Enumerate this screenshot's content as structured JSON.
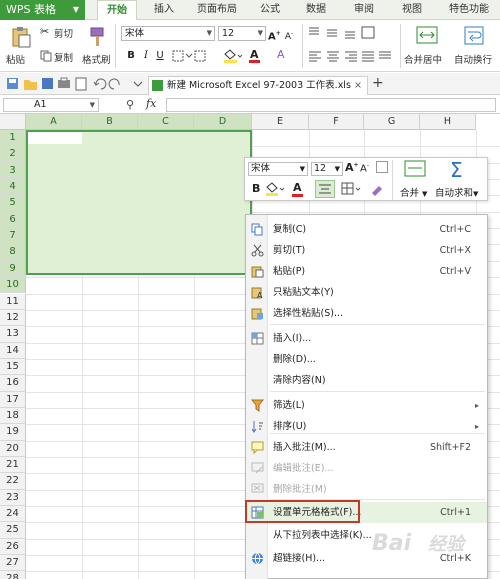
{
  "app": {
    "name": "WPS 表格"
  },
  "menu": {
    "tabs": [
      "开始",
      "插入",
      "页面布局",
      "公式",
      "数据",
      "审阅",
      "视图",
      "特色功能"
    ],
    "active": "开始"
  },
  "ribbon": {
    "paste": "粘贴",
    "cut": "剪切",
    "copy": "复制",
    "format_painter": "格式刷",
    "font": "宋体",
    "font_size": "12",
    "merge": "合并居中",
    "autowrap": "自动换行"
  },
  "file_tab": {
    "name": "新建 Microsoft Excel 97-2003 工作表.xls"
  },
  "formula_bar": {
    "name_box": "A1",
    "fx": "fx",
    "zoom_icon": "magnifier-icon"
  },
  "grid": {
    "columns": [
      "A",
      "B",
      "C",
      "D",
      "E",
      "F",
      "G",
      "H"
    ],
    "rows": [
      "1",
      "2",
      "3",
      "4",
      "5",
      "6",
      "7",
      "8",
      "9",
      "10",
      "11",
      "12",
      "13",
      "14",
      "15",
      "16",
      "17",
      "18",
      "19",
      "20",
      "21",
      "22",
      "23",
      "24",
      "25",
      "26",
      "27",
      "28"
    ],
    "selection": "A1:D10",
    "selection_color": "#dff0d5",
    "selection_border": "#4fa04f"
  },
  "mini_toolbar": {
    "font": "宋体",
    "size": "12",
    "bold": "B",
    "merge": "合并",
    "autosum": "自动求和"
  },
  "context_menu": {
    "items": [
      {
        "label": "复制(C)",
        "shortcut": "Ctrl+C",
        "icon": "copy-icon"
      },
      {
        "label": "剪切(T)",
        "shortcut": "Ctrl+X",
        "icon": "scissors-icon"
      },
      {
        "label": "粘贴(P)",
        "shortcut": "Ctrl+V",
        "icon": "paste-icon"
      },
      {
        "label": "只粘贴文本(Y)",
        "shortcut": "",
        "icon": "paste-text-icon"
      },
      {
        "label": "选择性粘贴(S)...",
        "shortcut": "",
        "icon": "paste-special-icon"
      },
      {
        "label": "插入(I)...",
        "shortcut": "",
        "icon": "insert-icon"
      },
      {
        "label": "删除(D)...",
        "shortcut": "",
        "icon": ""
      },
      {
        "label": "清除内容(N)",
        "shortcut": "",
        "icon": ""
      },
      {
        "label": "筛选(L)",
        "shortcut": "",
        "icon": "filter-icon"
      },
      {
        "label": "排序(U)",
        "shortcut": "",
        "icon": "sort-icon"
      },
      {
        "label": "插入批注(M)...",
        "shortcut": "Shift+F2",
        "icon": "comment-icon"
      },
      {
        "label": "编辑批注(E)...",
        "shortcut": "",
        "icon": "edit-comment-icon"
      },
      {
        "label": "删除批注(M)",
        "shortcut": "",
        "icon": "delete-comment-icon"
      },
      {
        "label": "设置单元格格式(F)...",
        "shortcut": "Ctrl+1",
        "icon": "format-cells-icon"
      },
      {
        "label": "从下拉列表中选择(K)...",
        "shortcut": "",
        "icon": ""
      },
      {
        "label": "超链接(H)...",
        "shortcut": "Ctrl+K",
        "icon": "hyperlink-icon"
      }
    ],
    "highlighted": "设置单元格格式(F)..."
  },
  "watermark": "Baidu经验"
}
